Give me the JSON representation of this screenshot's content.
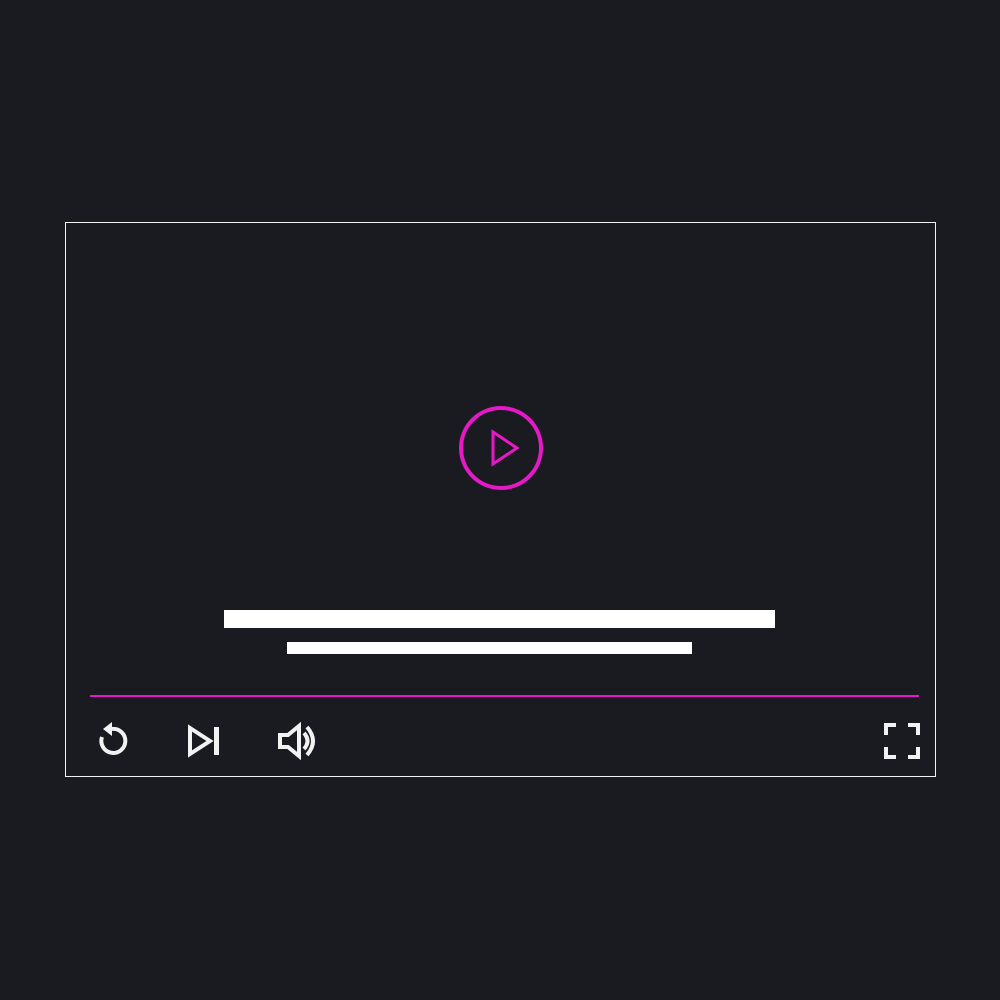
{
  "player": {
    "center_control": {
      "icon": "play-circle-icon",
      "color": "#e619c8",
      "label": ""
    },
    "captions": {
      "line_1": "",
      "line_2": "",
      "color": "#ffffff"
    },
    "progress": {
      "played_fraction": 1.0,
      "color": "#e619c8"
    },
    "controls": [
      {
        "name": "replay",
        "icon": "replay-icon",
        "label": ""
      },
      {
        "name": "next",
        "icon": "skip-next-icon",
        "label": ""
      },
      {
        "name": "volume",
        "icon": "volume-icon",
        "label": ""
      },
      {
        "name": "fullscreen",
        "icon": "fullscreen-icon",
        "label": ""
      }
    ],
    "colors": {
      "background": "#1a1a21",
      "frame_border": "#f2f2f2",
      "icon": "#f2f2f2",
      "accent": "#e619c8"
    }
  }
}
